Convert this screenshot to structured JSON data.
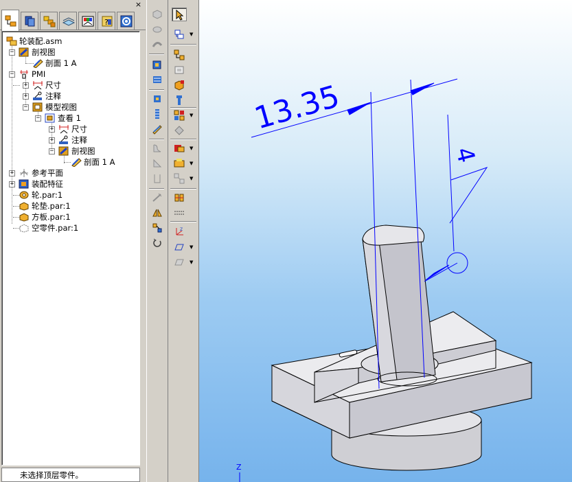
{
  "tree": {
    "root": "轮装配.asm",
    "section_view_group": "剖视图",
    "section_a": "剖面 1 A",
    "pmi": "PMI",
    "dimensions": "尺寸",
    "annotations": "注释",
    "model_views": "模型视图",
    "view_1": "查看 1",
    "view_dimensions": "尺寸",
    "view_annotations": "注释",
    "view_section_view": "剖视图",
    "view_section_a": "剖面 1 A",
    "reference_planes": "参考平面",
    "assembly_features": "装配特征",
    "part_wheel": "轮.par:1",
    "part_washer": "轮垫.par:1",
    "part_plate": "方板.par:1",
    "part_empty": "空零件.par:1"
  },
  "status": "未选择顶层零件。",
  "pane": {
    "close_glyph": "×"
  },
  "viewport": {
    "dimension_linear": "13.35",
    "dimension_weld": "4",
    "axis_z": "Z"
  },
  "colors": {
    "dimension_blue": "#0000ff",
    "part_gray": "#cfcfd6",
    "viewport_bottom": "#76b3ec"
  },
  "icons": {
    "tabs": [
      "assembly-tree-icon",
      "layers-icon",
      "parts-library-icon",
      "sketch-views-icon",
      "color-manager-icon",
      "properties-icon",
      "settings-icon"
    ]
  }
}
